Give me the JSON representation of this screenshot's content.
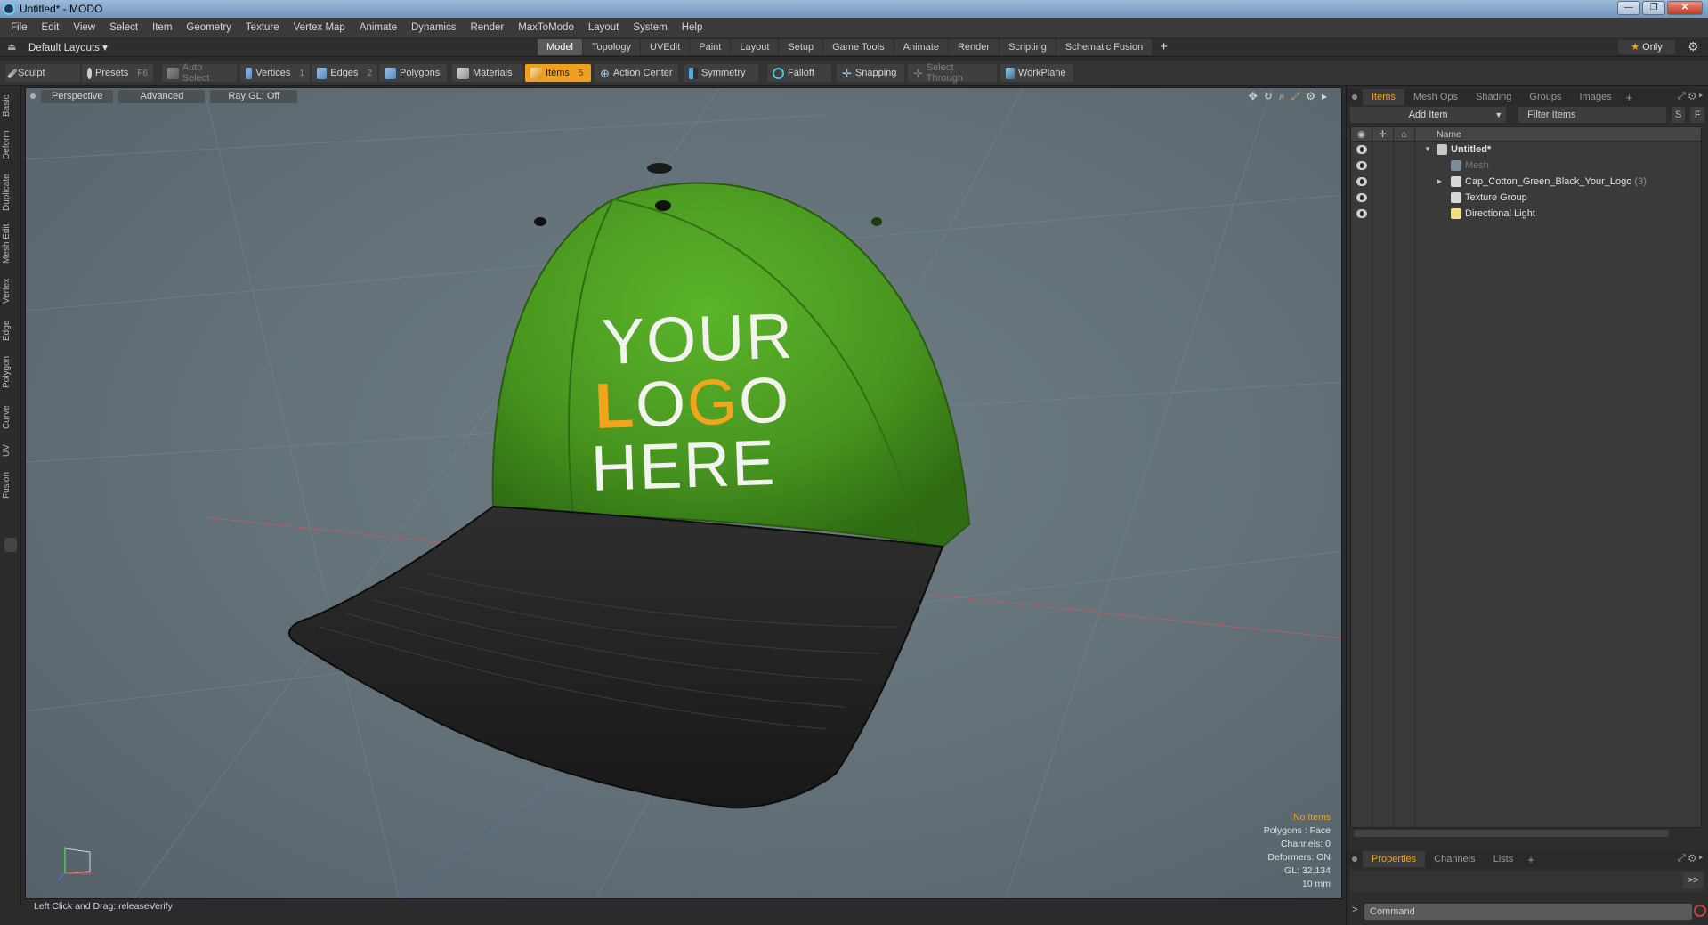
{
  "window": {
    "title": "Untitled* - MODO",
    "buttons": [
      "—",
      "❐",
      "✕"
    ]
  },
  "menu": [
    "File",
    "Edit",
    "View",
    "Select",
    "Item",
    "Geometry",
    "Texture",
    "Vertex Map",
    "Animate",
    "Dynamics",
    "Render",
    "MaxToModo",
    "Layout",
    "System",
    "Help"
  ],
  "layouts": {
    "selector": "Default Layouts ▾",
    "tabs": [
      "Model",
      "Topology",
      "UVEdit",
      "Paint",
      "Layout",
      "Setup",
      "Game Tools",
      "Animate",
      "Render",
      "Scripting",
      "Schematic Fusion"
    ],
    "active_tab": "Model",
    "add": "+",
    "only_star": "★",
    "only": "Only",
    "settings_icon": "gear-icon"
  },
  "toolbar": {
    "sculpt": "Sculpt",
    "presets": "Presets",
    "presets_key": "F6",
    "auto_select": "Auto Select",
    "vertices": "Vertices",
    "vertices_key": "1",
    "edges": "Edges",
    "edges_key": "2",
    "polygons": "Polygons",
    "materials": "Materials",
    "items": "Items",
    "items_key": "5",
    "action_center": "Action Center",
    "symmetry": "Symmetry",
    "falloff": "Falloff",
    "snapping": "Snapping",
    "select_through": "Select Through",
    "workplane": "WorkPlane",
    "accent": "#f0a01c"
  },
  "left_tabs": [
    "Basic",
    "Deform",
    "Duplicate",
    "Mesh Edit",
    "Vertex",
    "Edge",
    "Polygon",
    "Curve",
    "UV",
    "Fusion"
  ],
  "viewport": {
    "view": "Perspective",
    "mode": "Advanced",
    "raygl": "Ray GL: Off",
    "logo_line1": "YOUR",
    "logo_l": "L",
    "logo_o": "O",
    "logo_g": "G",
    "logo_o2": "O",
    "logo_line3": "HERE",
    "cap_crown_color": "#4a9a1e",
    "cap_brim_color": "#262626",
    "logo_accent": "#f2a51c",
    "info": {
      "selection": "No Items",
      "polygons": "Polygons : Face",
      "channels": "Channels: 0",
      "deformers": "Deformers: ON",
      "gl": "GL: 32,134",
      "scale": "10 mm"
    }
  },
  "status": "Left Click and Drag:   releaseVerify",
  "items_panel": {
    "tabs": [
      "Items",
      "Mesh Ops",
      "Shading",
      "Groups",
      "Images"
    ],
    "active_tab": "Items",
    "add_tab": "+",
    "add_item": "Add Item",
    "filter": "Filter Items",
    "s_btn": "S",
    "f_btn": "F",
    "column_name": "Name",
    "tree": [
      {
        "label": "Untitled*",
        "type": "scene",
        "count": ""
      },
      {
        "label": "Mesh",
        "type": "mesh",
        "count": ""
      },
      {
        "label": "Cap_Cotton_Green_Black_Your_Logo",
        "type": "group",
        "count": "(3)"
      },
      {
        "label": "Texture Group",
        "type": "group",
        "count": ""
      },
      {
        "label": "Directional Light",
        "type": "light",
        "count": ""
      }
    ]
  },
  "bottom_panel": {
    "tabs": [
      "Properties",
      "Channels",
      "Lists"
    ],
    "active_tab": "Properties",
    "add_tab": "+",
    "go": ">>",
    "prompt": ">",
    "command_placeholder": "Command"
  }
}
